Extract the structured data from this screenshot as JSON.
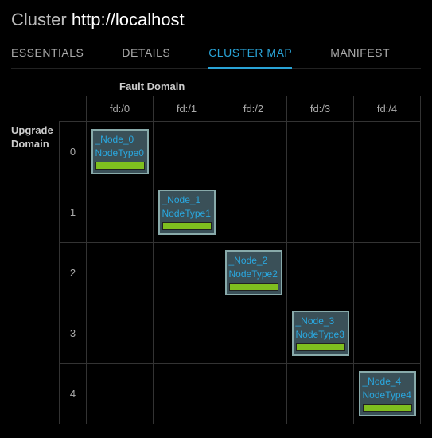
{
  "header": {
    "title_prefix": "Cluster",
    "title_host": "http://localhost"
  },
  "tabs": [
    {
      "label": "ESSENTIALS",
      "active": false
    },
    {
      "label": "DETAILS",
      "active": false
    },
    {
      "label": "CLUSTER MAP",
      "active": true
    },
    {
      "label": "MANIFEST",
      "active": false
    }
  ],
  "axis": {
    "fault_domain_label": "Fault Domain",
    "upgrade_domain_label": "Upgrade Domain",
    "fault_domains": [
      "fd:/0",
      "fd:/1",
      "fd:/2",
      "fd:/3",
      "fd:/4"
    ],
    "upgrade_domains": [
      "0",
      "1",
      "2",
      "3",
      "4"
    ]
  },
  "nodes": [
    {
      "ud": 0,
      "fd": 0,
      "name": "_Node_0",
      "type": "NodeType0",
      "health": "ok"
    },
    {
      "ud": 1,
      "fd": 1,
      "name": "_Node_1",
      "type": "NodeType1",
      "health": "ok"
    },
    {
      "ud": 2,
      "fd": 2,
      "name": "_Node_2",
      "type": "NodeType2",
      "health": "ok"
    },
    {
      "ud": 3,
      "fd": 3,
      "name": "_Node_3",
      "type": "NodeType3",
      "health": "ok"
    },
    {
      "ud": 4,
      "fd": 4,
      "name": "_Node_4",
      "type": "NodeType4",
      "health": "ok"
    }
  ],
  "colors": {
    "accent": "#29a3d6",
    "health_ok": "#7fbf1f",
    "node_bg": "#3a5058",
    "node_border": "#88aaaa"
  }
}
